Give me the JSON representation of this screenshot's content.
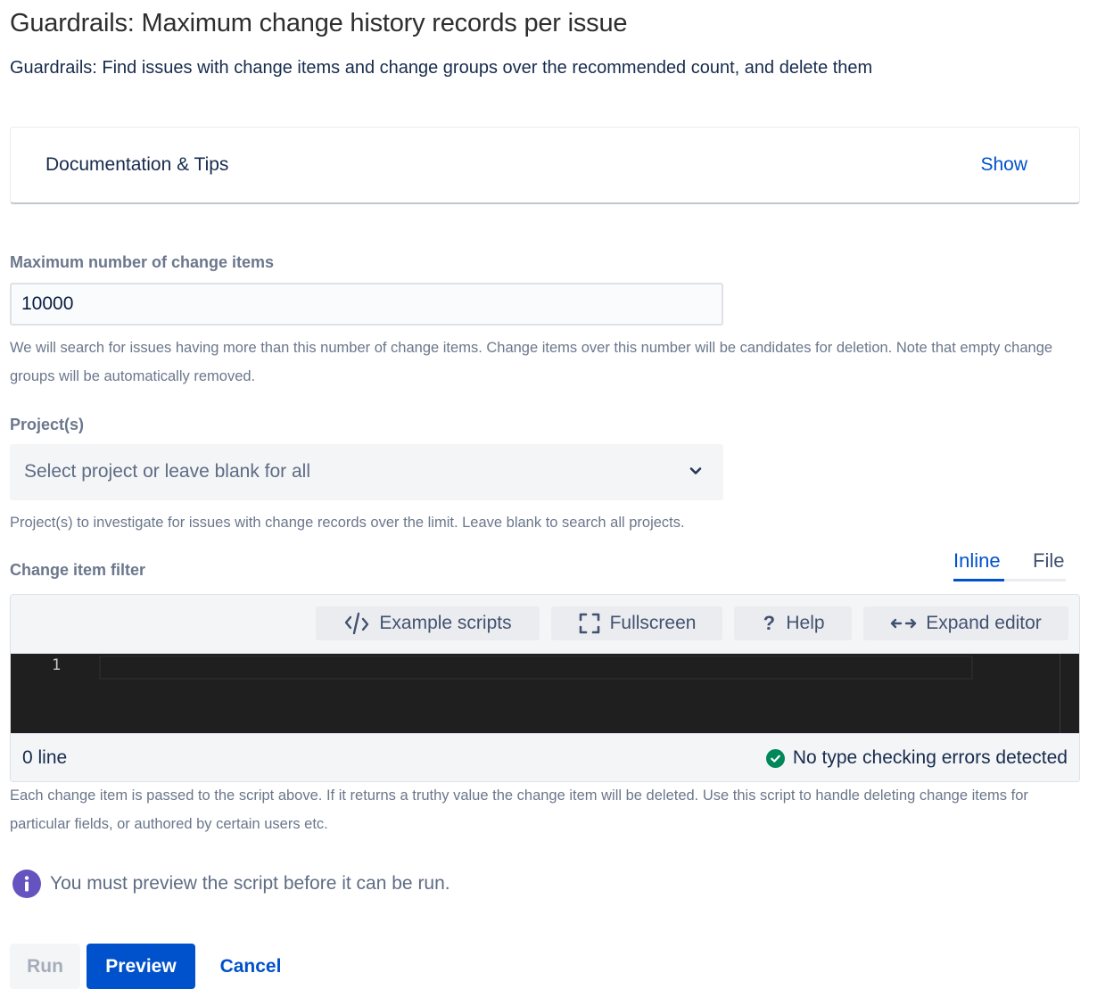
{
  "header": {
    "title": "Guardrails: Maximum change history records per issue",
    "subtitle": "Guardrails: Find issues with change items and change groups over the recommended count, and delete them"
  },
  "documentation": {
    "title": "Documentation & Tips",
    "toggle_label": "Show"
  },
  "max_change_items": {
    "label": "Maximum number of change items",
    "value": "10000",
    "help": "We will search for issues having more than this number of change items. Change items over this number will be candidates for deletion. Note that empty change groups will be automatically removed."
  },
  "projects": {
    "label": "Project(s)",
    "placeholder": "Select project or leave blank for all",
    "help": "Project(s) to investigate for issues with change records over the limit. Leave blank to search all projects."
  },
  "change_item_filter": {
    "label": "Change item filter",
    "tabs": [
      {
        "label": "Inline",
        "active": true
      },
      {
        "label": "File",
        "active": false
      }
    ],
    "toolbar": {
      "example_scripts": "Example scripts",
      "fullscreen": "Fullscreen",
      "help": "Help",
      "expand_editor": "Expand editor"
    },
    "editor": {
      "line_numbers": [
        "1"
      ],
      "content": ""
    },
    "status": {
      "line_count": "0 line",
      "type_check": "No type checking errors detected"
    },
    "help": "Each change item is passed to the script above. If it returns a truthy value the change item will be deleted. Use this script to handle deleting change items for particular fields, or authored by certain users etc."
  },
  "info_message": "You must preview the script before it can be run.",
  "actions": {
    "run": "Run",
    "preview": "Preview",
    "cancel": "Cancel"
  },
  "colors": {
    "primary": "#0052CC",
    "success": "#00875A",
    "info": "#6554C0",
    "editor_bg": "#1F1F1F"
  }
}
